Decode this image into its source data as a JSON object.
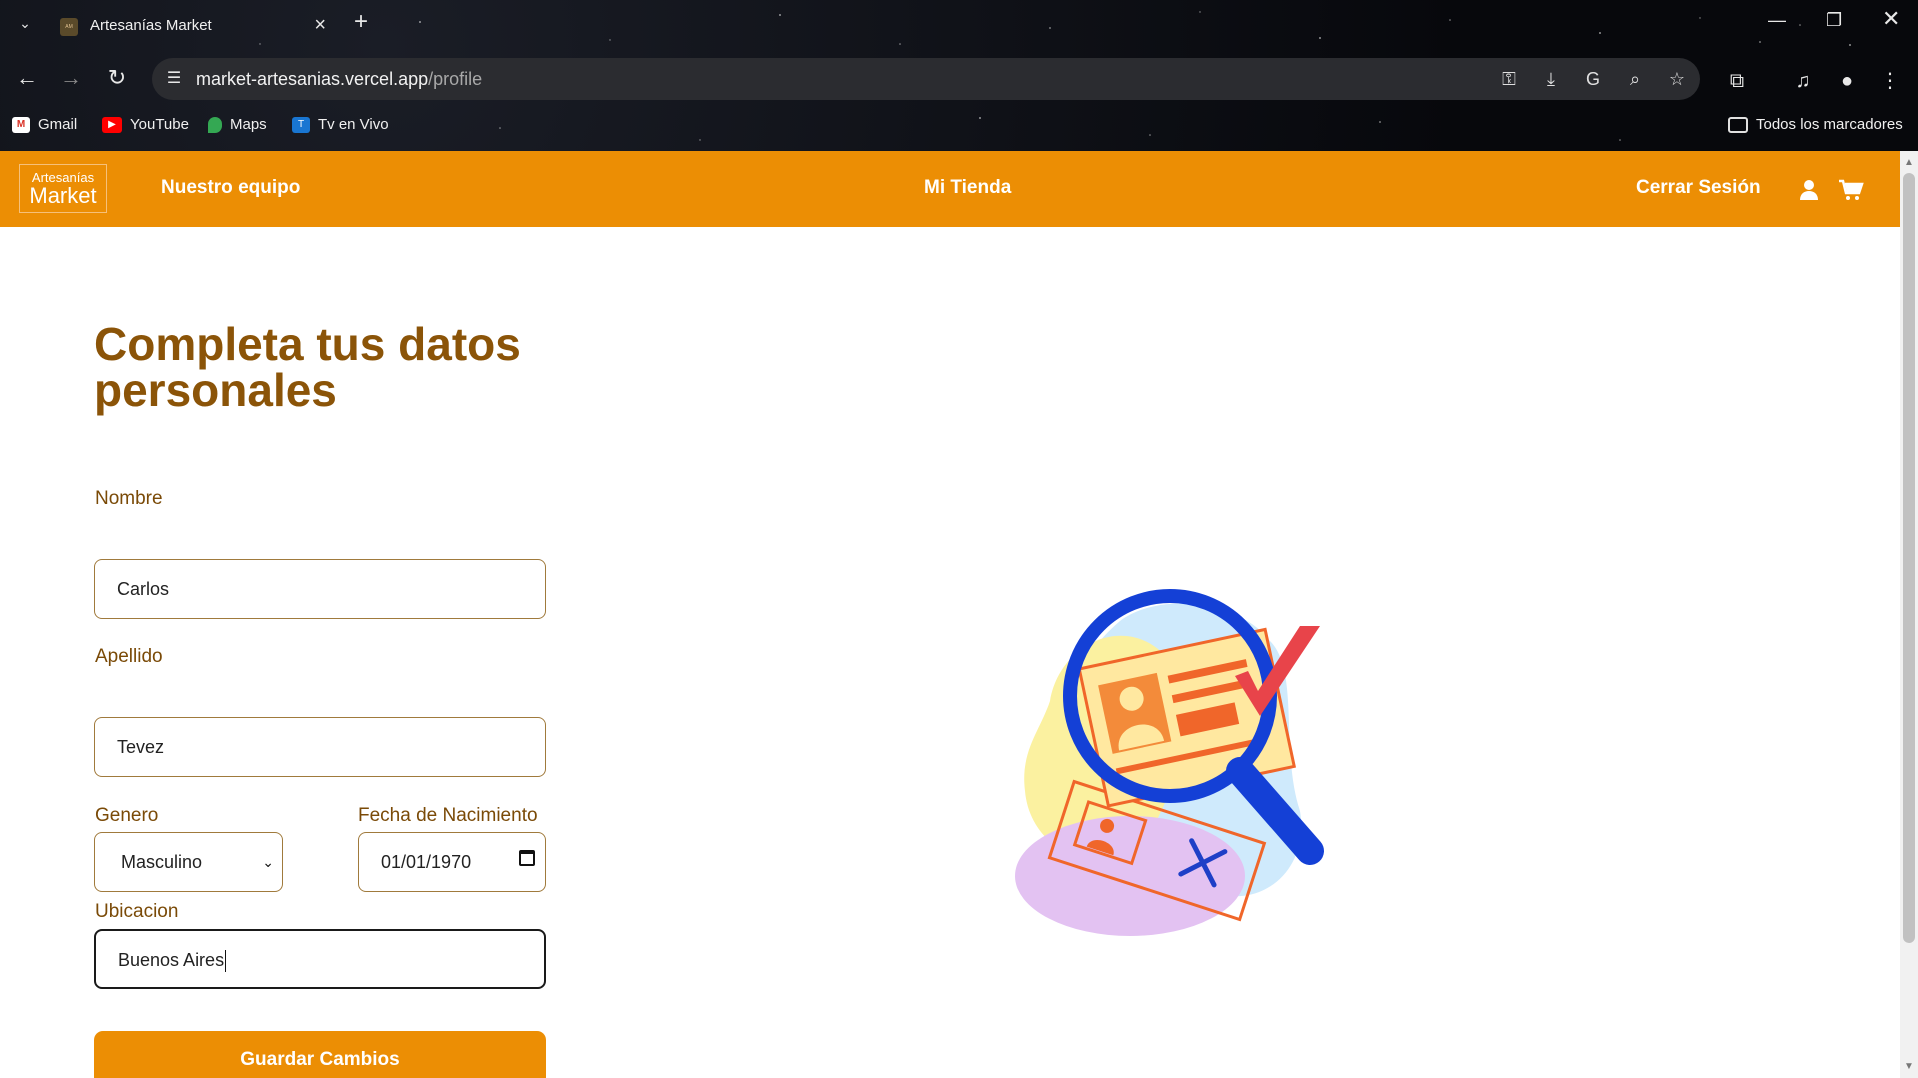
{
  "browser": {
    "tab_title": "Artesanías Market",
    "url_host": "market-artesanias.vercel.app",
    "url_path": "/profile",
    "bookmarks": [
      "Gmail",
      "YouTube",
      "Maps",
      "Tv en Vivo"
    ],
    "all_bookmarks": "Todos los marcadores"
  },
  "nav": {
    "logo_line1": "Artesanías",
    "logo_line2": "Market",
    "team": "Nuestro equipo",
    "store": "Mi Tienda",
    "logout": "Cerrar Sesión"
  },
  "form": {
    "heading": "Completa tus datos personales",
    "name_label": "Nombre",
    "name_value": "Carlos",
    "surname_label": "Apellido",
    "surname_value": "Tevez",
    "gender_label": "Genero",
    "gender_value": "Masculino",
    "birth_label": "Fecha de Nacimiento",
    "birth_value": "01/01/1970",
    "location_label": "Ubicacion",
    "location_value": "Buenos Aires",
    "save_label": "Guardar Cambios"
  },
  "colors": {
    "brand_orange": "#ec8e04",
    "heading_brown": "#8b5408"
  },
  "icons": [
    "user-icon",
    "cart-icon",
    "key-icon",
    "install-icon",
    "translate-icon",
    "zoom-icon",
    "star-icon",
    "extensions-icon",
    "media-icon",
    "profile-icon",
    "menu-icon"
  ]
}
